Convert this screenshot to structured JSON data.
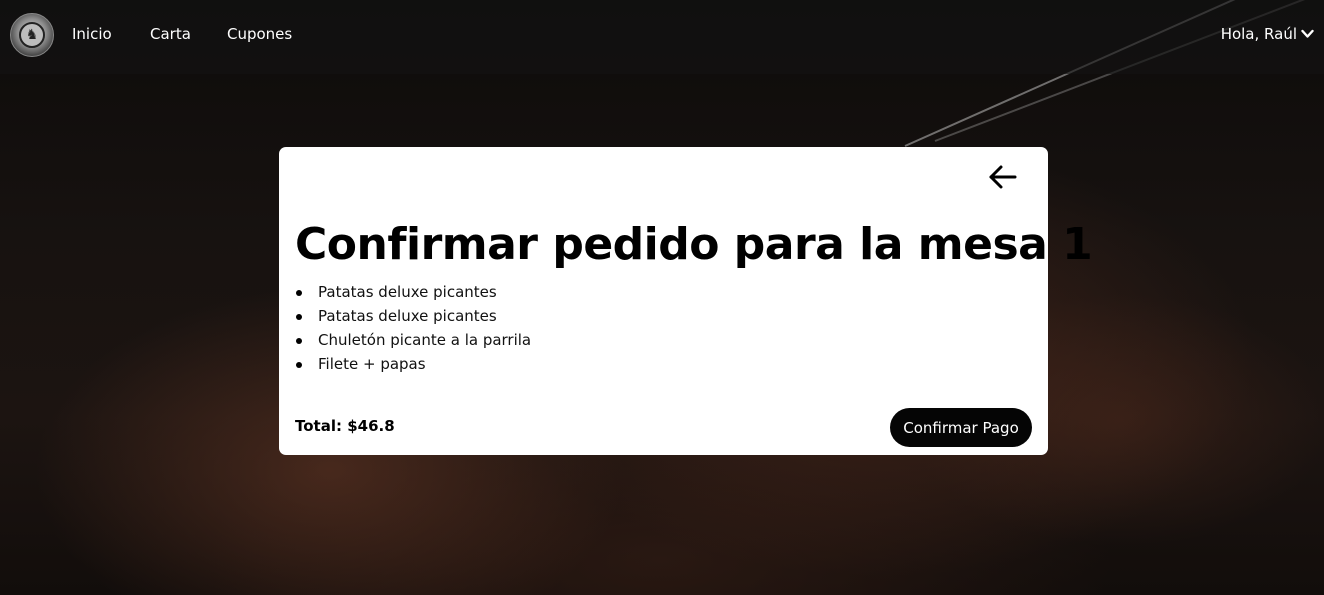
{
  "nav": {
    "links": [
      "Inicio",
      "Carta",
      "Cupones"
    ],
    "user_greeting": "Hola, Raúl",
    "user_menu_icon": "chevron-down-icon",
    "logo_icon": "restaurant-logo"
  },
  "order": {
    "back_icon": "arrow-left-icon",
    "title": "Confirmar pedido para la mesa 1",
    "items": [
      "Patatas deluxe picantes",
      "Patatas deluxe picantes",
      "Chuletón picante a la parrila",
      "Filete + papas"
    ],
    "total": "Total: $46.8",
    "confirm_label": "Confirmar Pago"
  },
  "colors": {
    "navbar": "#141414",
    "card": "#ffffff",
    "button": "#050505"
  }
}
